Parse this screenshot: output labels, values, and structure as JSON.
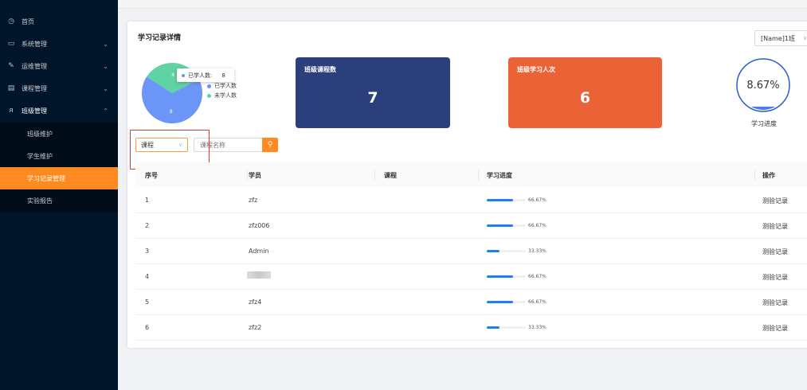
{
  "sidebar": {
    "items": [
      {
        "label": "首页",
        "icon": "clock-icon"
      },
      {
        "label": "系统管理",
        "icon": "monitor-icon"
      },
      {
        "label": "运维管理",
        "icon": "wrench-icon"
      },
      {
        "label": "课程管理",
        "icon": "book-icon"
      },
      {
        "label": "班级管理",
        "icon": "users-icon"
      }
    ],
    "sub_items": [
      {
        "label": "班级维护"
      },
      {
        "label": "学生维护"
      },
      {
        "label": "学习记录管理"
      },
      {
        "label": "实验报告"
      }
    ]
  },
  "card": {
    "title": "学习记录详情",
    "class_select": "[Name]1班"
  },
  "pie": {
    "tooltip_label": "已学人数:",
    "tooltip_value": "8",
    "legend": [
      {
        "label": "已学人数",
        "color": "#6b95f7"
      },
      {
        "label": "未学人数",
        "color": "#5fd3a3"
      }
    ],
    "slice_labels": [
      "4",
      "8"
    ],
    "values": [
      8,
      4
    ]
  },
  "stats": {
    "course_label": "班级课程数",
    "course_value": "7",
    "study_label": "班级学习人次",
    "study_value": "6"
  },
  "progress": {
    "value_text": "8.67%",
    "fraction": 0.0867,
    "label": "学习进度"
  },
  "filter": {
    "select_value": "课程",
    "search_placeholder": "课程名称"
  },
  "table": {
    "headers": [
      "序号",
      "学员",
      "课程",
      "学习进度",
      "操作"
    ],
    "rows": [
      {
        "index": "1",
        "name": "zfz",
        "course": "",
        "pct_text": "66.67%",
        "pct": 0.6667,
        "action": "测验记录"
      },
      {
        "index": "2",
        "name": "zfz006",
        "course": "",
        "pct_text": "66.67%",
        "pct": 0.6667,
        "action": "测验记录"
      },
      {
        "index": "3",
        "name": "Admin",
        "course": "",
        "pct_text": "33.33%",
        "pct": 0.3333,
        "action": "测验记录"
      },
      {
        "index": "4",
        "name": "",
        "course": "",
        "pct_text": "66.67%",
        "pct": 0.6667,
        "action": "测验记录"
      },
      {
        "index": "5",
        "name": "zfz4",
        "course": "",
        "pct_text": "66.67%",
        "pct": 0.6667,
        "action": "测验记录"
      },
      {
        "index": "6",
        "name": "zfz2",
        "course": "",
        "pct_text": "33.33%",
        "pct": 0.3333,
        "action": "测验记录"
      }
    ]
  },
  "colors": {
    "accent": "#ff8a1f",
    "sidebar_bg": "#001529",
    "bar_blue": "#1e7ef0",
    "stat_blue": "#2b3f7c",
    "stat_orange": "#eb6236"
  }
}
